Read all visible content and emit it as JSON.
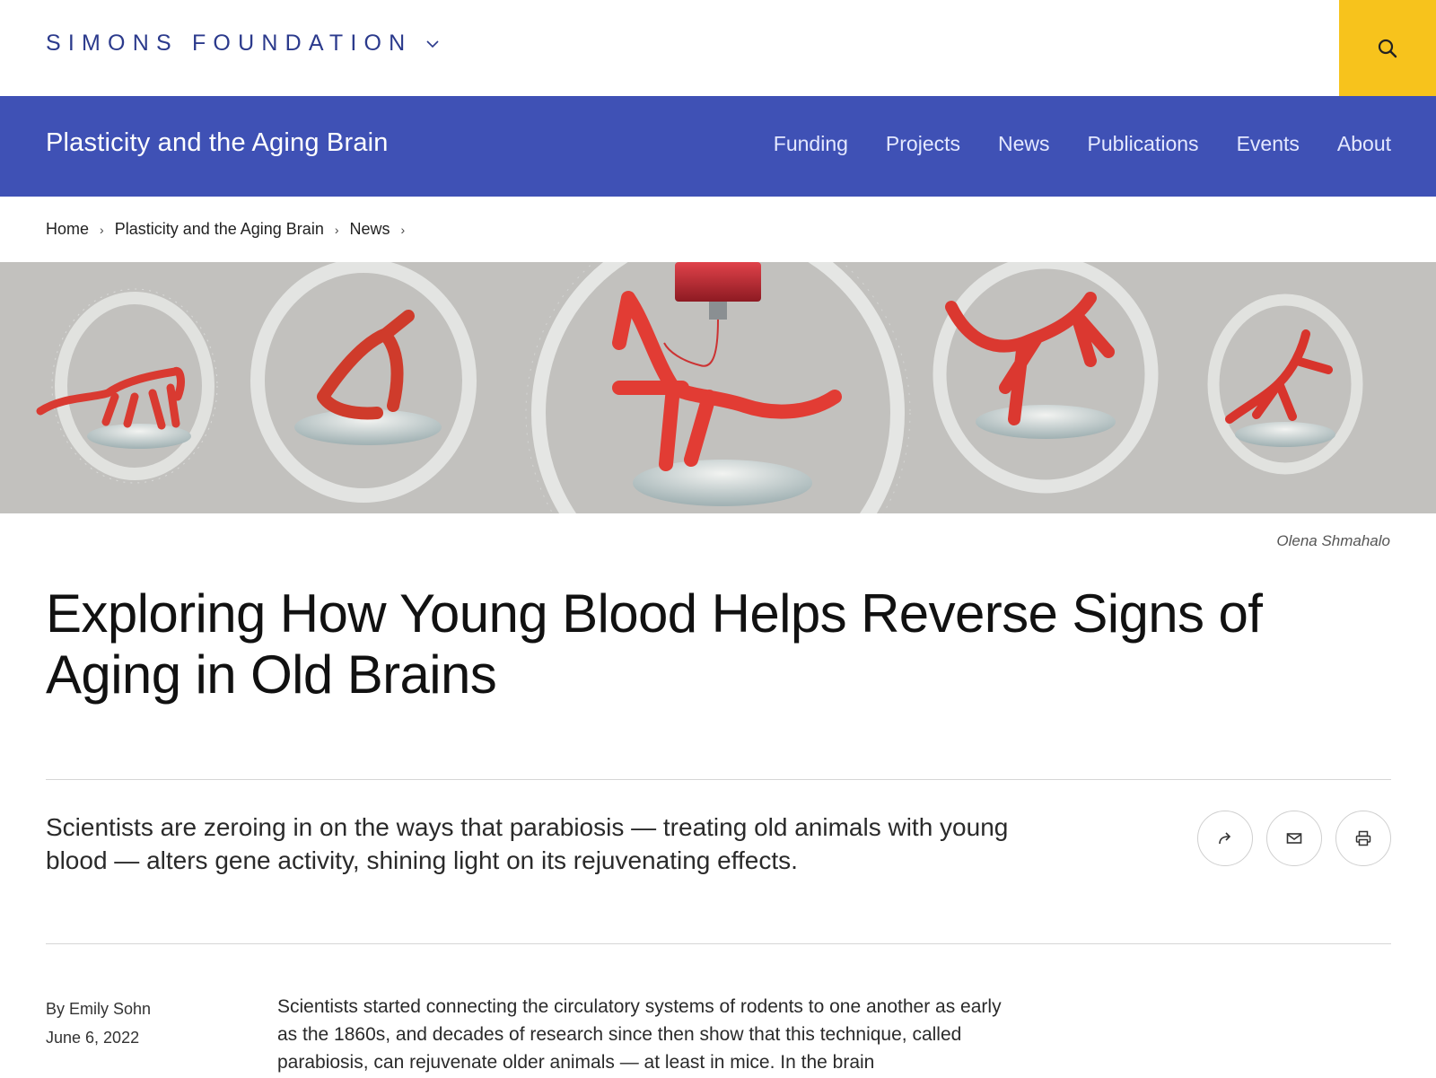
{
  "header": {
    "logo_text": "SIMONS FOUNDATION",
    "accent_color": "#f7c31c",
    "search_icon": "search-icon"
  },
  "program_nav": {
    "title": "Plasticity and the Aging Brain",
    "background": "#3f51b5",
    "links": [
      "Funding",
      "Projects",
      "News",
      "Publications",
      "Events",
      "About"
    ]
  },
  "breadcrumb": [
    "Home",
    "Plasticity and the Aging Brain",
    "News"
  ],
  "hero": {
    "credit": "Olena Shmahalo"
  },
  "article": {
    "title": "Exploring How Young Blood Helps Reverse Signs of Aging in Old Brains",
    "dek": "Scientists are zeroing in on the ways that parabiosis — treating old animals with young blood — alters gene activity, shining light on its rejuvenating effects.",
    "byline": "By Emily Sohn",
    "date": "June 6, 2022",
    "body_intro": "Scientists started connecting the circulatory systems of rodents to one another as early as the 1860s, and decades of research since then show that this technique, called parabiosis, can rejuvenate older animals — at least in mice. In the brain"
  },
  "share_buttons": [
    "share-icon",
    "email-icon",
    "print-icon"
  ]
}
